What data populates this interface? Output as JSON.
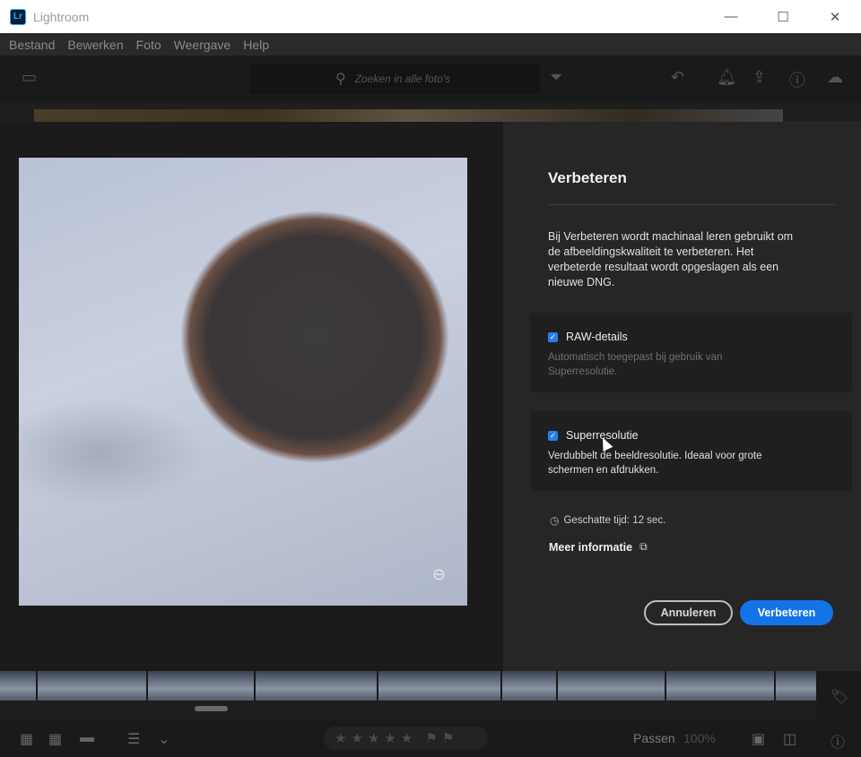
{
  "window": {
    "app_icon": "Lr",
    "title": "Lightroom",
    "controls": [
      "—",
      "☐",
      "✕"
    ]
  },
  "menu": [
    "Bestand",
    "Bewerken",
    "Foto",
    "Weergave",
    "Help"
  ],
  "toolbar": {
    "search_placeholder": "Zoeken in alle foto's"
  },
  "dialog": {
    "title": "Verbeteren",
    "description": "Bij Verbeteren wordt machinaal leren gebruikt om de afbeeldingskwaliteit te verbeteren. Het verbeterde resultaat wordt opgeslagen als een nieuwe DNG.",
    "options": [
      {
        "label": "RAW-details",
        "checked": true,
        "sub": "Automatisch toegepast bij gebruik van Superresolutie."
      },
      {
        "label": "Superresolutie",
        "checked": true,
        "sub": "Verdubbelt de beeldresolutie. Ideaal voor grote schermen en afdrukken."
      }
    ],
    "estimate": "Geschatte tijd: 12 sec.",
    "more_info": "Meer informatie",
    "cancel_label": "Annuleren",
    "ok_label": "Verbeteren",
    "accent_color": "#1473e6"
  },
  "bottombar": {
    "fit_label": "Passen",
    "zoom_value": "100%"
  }
}
